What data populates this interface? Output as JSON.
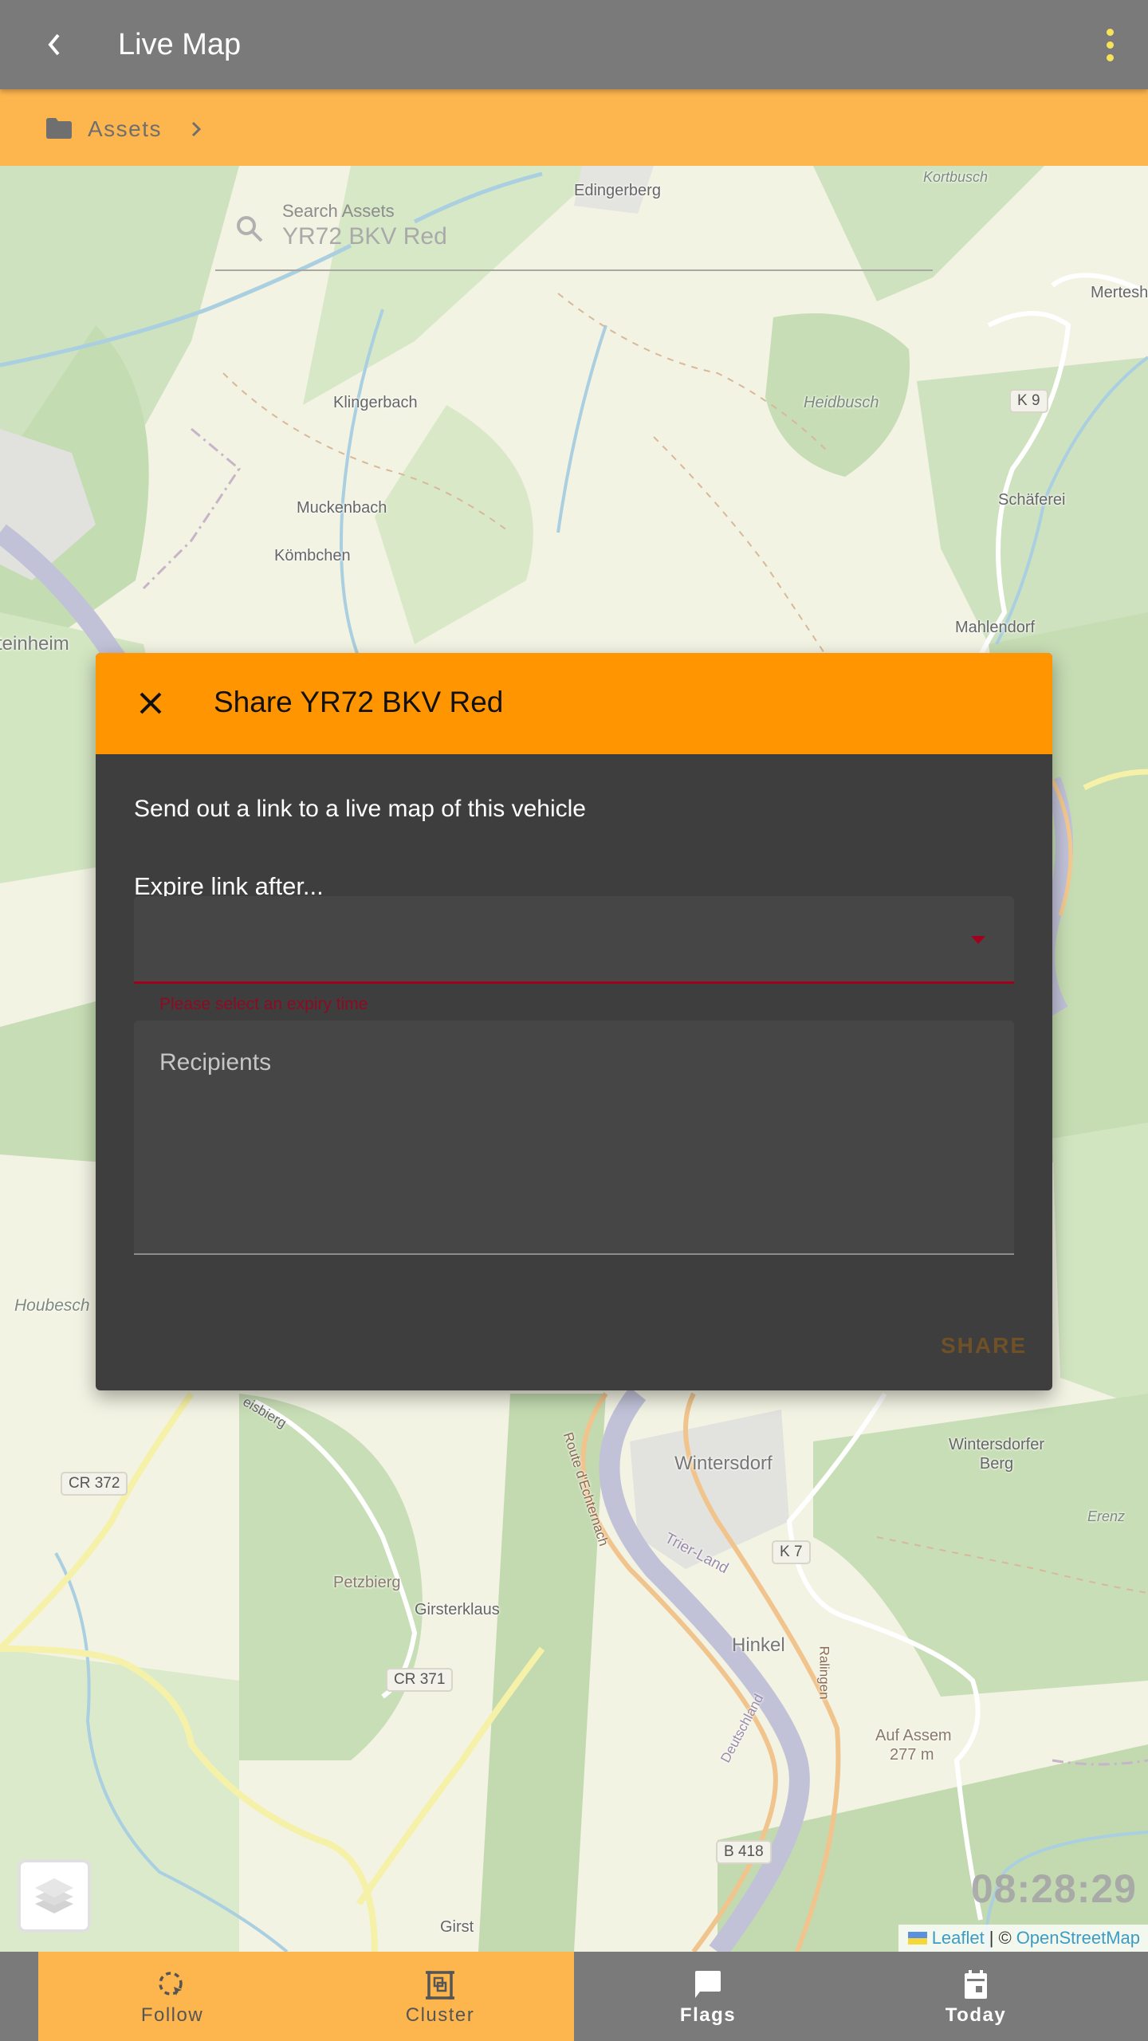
{
  "appbar": {
    "title": "Live Map",
    "back_icon": "chevron-left-icon",
    "menu_icon": "more-vert-icon"
  },
  "breadcrumb": {
    "folder_icon": "folder-icon",
    "items": [
      "Assets"
    ],
    "separator_icon": "chevron-right-icon"
  },
  "search": {
    "label": "Search Assets",
    "value": "YR72 BKV Red",
    "icon": "search-icon"
  },
  "map": {
    "labels": [
      "Edingerberg",
      "Kortbusch",
      "Klingerbach",
      "Heidbusch",
      "K 9",
      "Mertesh",
      "Schäferei",
      "Muckenbach",
      "Kömbchen",
      "Mahlendorf",
      "teinheim",
      "Houbesch",
      "Wintersdorfer Berg",
      "Wintersdorf",
      "Erenz",
      "CR 372",
      "K 7",
      "Trier-Land",
      "Petzbierg",
      "Girsterklaus",
      "Hinkel",
      "CR 371",
      "Auf Assem",
      "277 m",
      "B 418",
      "Girst",
      "Route d'Echternach",
      "Ralingen",
      "Deutschland",
      "eisbierg"
    ],
    "clock": "08:28:29",
    "attribution": {
      "leaflet": "Leaflet",
      "separator": "|",
      "copyright": "©",
      "osm": "OpenStreetMap"
    },
    "layers_icon": "layers-icon"
  },
  "modal": {
    "title": "Share YR72 BKV Red",
    "close_icon": "close-icon",
    "description": "Send out a link to a live map of this vehicle",
    "expire_label": "Expire link after...",
    "expire_value": "",
    "expire_error": "Please select an expiry time",
    "recipients_placeholder": "Recipients",
    "share_label": "SHARE",
    "colors": {
      "header": "#ff9500",
      "body": "#3e3e3e",
      "error": "#a3001e"
    }
  },
  "bottom_nav": {
    "items": [
      {
        "label": "Follow",
        "icon": "follow-icon",
        "active": true
      },
      {
        "label": "Cluster",
        "icon": "cluster-icon",
        "active": true
      },
      {
        "label": "Flags",
        "icon": "flag-comment-icon",
        "active": false
      },
      {
        "label": "Today",
        "icon": "calendar-today-icon",
        "active": false
      }
    ]
  },
  "colors": {
    "appbar": "#7a7a7a",
    "accent": "#fdb54d",
    "menu_dots": "#f5e45a"
  }
}
